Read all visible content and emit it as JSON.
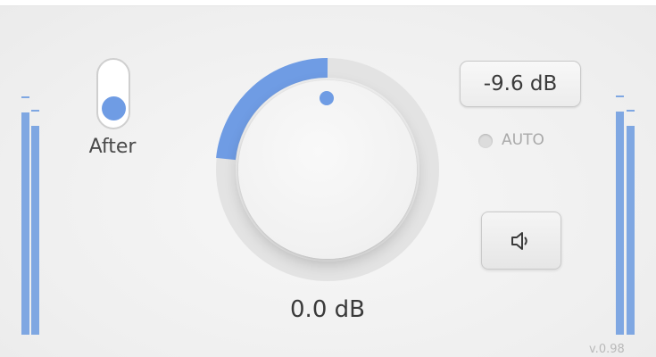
{
  "toggle": {
    "label": "After",
    "state": "on",
    "accent_color": "#6f9ce4"
  },
  "knob": {
    "value_label": "0.0 dB",
    "accent_color": "#6f9ce4"
  },
  "output_gain": {
    "value_label": "-9.6 dB"
  },
  "auto": {
    "label": "AUTO",
    "enabled": false
  },
  "speaker_button": {
    "icon": "speaker-icon"
  },
  "meters": {
    "color": "#7fa7e2",
    "left_label": "input-meter",
    "right_label": "output-meter"
  },
  "footer": {
    "version": "v.0.98"
  }
}
